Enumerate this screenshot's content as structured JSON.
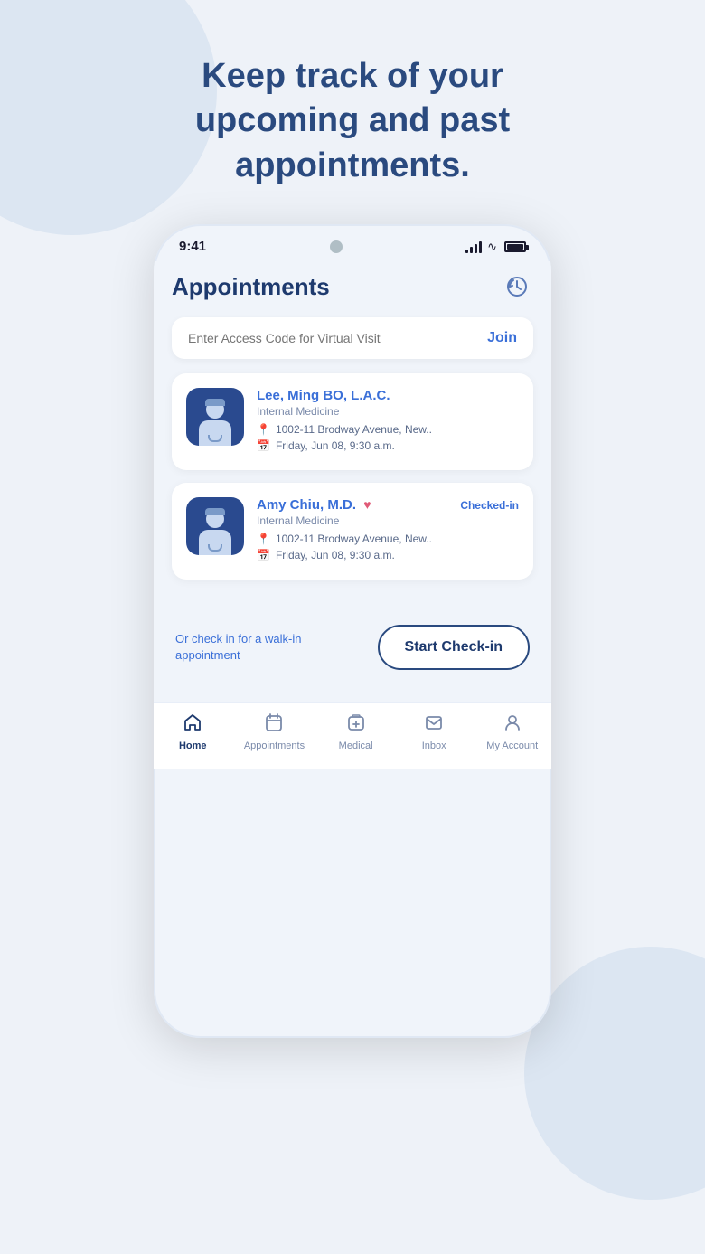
{
  "page": {
    "background_color": "#eef2f8"
  },
  "headline": {
    "text": "Keep track of your upcoming and past appointments."
  },
  "phone": {
    "time": "9:41",
    "screen_title": "Appointments",
    "access_code_placeholder": "Enter Access Code for Virtual Visit",
    "join_label": "Join",
    "appointments": [
      {
        "id": "appt-1",
        "doctor_name": "Lee, Ming BO, L.A.C.",
        "specialty": "Internal Medicine",
        "address": "1002-11 Brodway Avenue, New..",
        "datetime": "Friday, Jun 08, 9:30 a.m.",
        "checked_in": false,
        "heart": false
      },
      {
        "id": "appt-2",
        "doctor_name": "Amy Chiu, M.D.",
        "specialty": "Internal Medicine",
        "address": "1002-11 Brodway Avenue, New..",
        "datetime": "Friday, Jun 08, 9:30 a.m.",
        "checked_in": true,
        "checked_in_label": "Checked-in",
        "heart": true
      }
    ],
    "walk_in_text": "Or check in for a walk-in appointment",
    "start_checkin_label": "Start Check-in",
    "nav_items": [
      {
        "id": "home",
        "label": "Home",
        "active": true,
        "icon": "house"
      },
      {
        "id": "appointments",
        "label": "Appointments",
        "active": false,
        "icon": "calendar"
      },
      {
        "id": "medical",
        "label": "Medical",
        "active": false,
        "icon": "medical"
      },
      {
        "id": "inbox",
        "label": "Inbox",
        "active": false,
        "icon": "envelope"
      },
      {
        "id": "account",
        "label": "My Account",
        "active": false,
        "icon": "person"
      }
    ]
  }
}
